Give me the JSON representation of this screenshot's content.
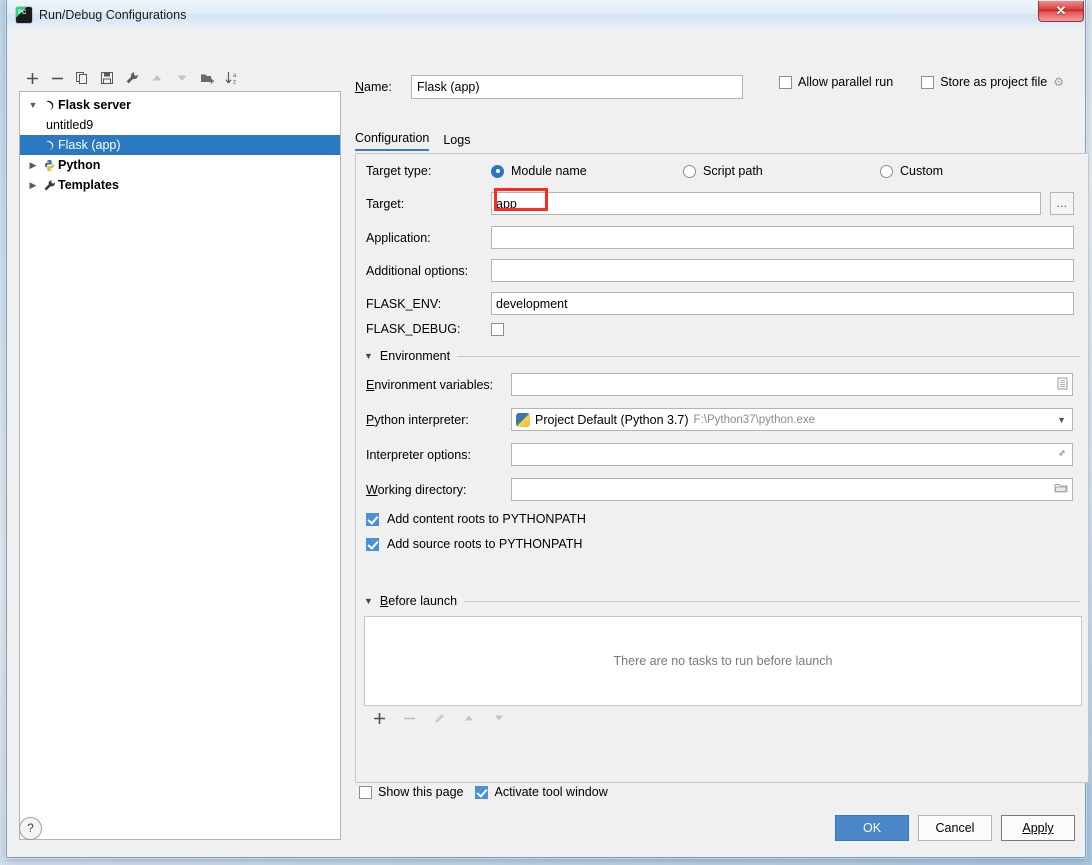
{
  "window": {
    "title": "Run/Debug Configurations",
    "app_icon": "pycharm-icon",
    "close_label": "✕"
  },
  "toolbar": {
    "buttons": [
      {
        "name": "add-configuration-button",
        "icon": "plus-icon",
        "label": "+",
        "disabled": false
      },
      {
        "name": "remove-configuration-button",
        "icon": "minus-icon",
        "label": "−",
        "disabled": false
      },
      {
        "name": "copy-configuration-button",
        "icon": "copy-icon",
        "label": "",
        "disabled": false
      },
      {
        "name": "save-configuration-button",
        "icon": "save-icon",
        "label": "",
        "disabled": false
      },
      {
        "name": "edit-templates-button",
        "icon": "wrench-icon",
        "label": "",
        "disabled": false
      },
      {
        "name": "move-up-button",
        "icon": "arrow-up-icon",
        "label": "▲",
        "disabled": true
      },
      {
        "name": "move-down-button",
        "icon": "arrow-down-icon",
        "label": "▼",
        "disabled": true
      },
      {
        "name": "new-folder-button",
        "icon": "folder-add-icon",
        "label": "",
        "disabled": false
      },
      {
        "name": "sort-configurations-button",
        "icon": "sort-az-icon",
        "label": "",
        "disabled": false
      }
    ]
  },
  "tree": {
    "nodes": [
      {
        "label": "Flask server",
        "indent": 0,
        "twisty": "expanded",
        "icon": "flask-icon",
        "bold": true,
        "selected": false
      },
      {
        "label": "untitled9",
        "indent": 2,
        "twisty": "none",
        "icon": "none",
        "bold": false,
        "selected": false
      },
      {
        "label": "Flask (app)",
        "indent": 1,
        "twisty": "none",
        "icon": "flask-icon",
        "bold": false,
        "selected": true
      },
      {
        "label": "Python",
        "indent": 0,
        "twisty": "collapsed",
        "icon": "python-icon",
        "bold": true,
        "selected": false
      },
      {
        "label": "Templates",
        "indent": 0,
        "twisty": "collapsed",
        "icon": "wrench-icon",
        "bold": true,
        "selected": false
      }
    ]
  },
  "header": {
    "name_label": "Name:",
    "name_value": "Flask (app)",
    "allow_parallel_run_label": "Allow parallel run",
    "allow_parallel_run_checked": false,
    "store_as_project_file_label": "Store as project file",
    "store_as_project_file_checked": false,
    "gear_icon": "gear-icon"
  },
  "tabs": [
    {
      "label": "Configuration",
      "active": true
    },
    {
      "label": "Logs",
      "active": false
    }
  ],
  "form": {
    "target_type_label": "Target type:",
    "target_type_options": [
      {
        "label": "Module name",
        "selected": true
      },
      {
        "label": "Script path",
        "selected": false
      },
      {
        "label": "Custom",
        "selected": false
      }
    ],
    "target_label": "Target:",
    "target_value": "app",
    "target_browse_label": "...",
    "application_label": "Application:",
    "application_value": "",
    "additional_options_label": "Additional options:",
    "additional_options_value": "",
    "flask_env_label": "FLASK_ENV:",
    "flask_env_value": "development",
    "flask_debug_label": "FLASK_DEBUG:",
    "flask_debug_checked": false,
    "environment_section_label": "Environment",
    "environment_variables_label": "Environment variables:",
    "environment_variables_value": "",
    "environment_variables_icon": "list-editor-icon",
    "python_interpreter_label": "Python interpreter:",
    "python_interpreter_value": "Project Default (Python 3.7)",
    "python_interpreter_path": "F:\\Python37\\python.exe",
    "python_interpreter_icon": "python-icon",
    "interpreter_options_label": "Interpreter options:",
    "interpreter_options_value": "",
    "interpreter_options_icon": "expand-icon",
    "working_directory_label": "Working directory:",
    "working_directory_value": "",
    "working_directory_icon": "folder-icon",
    "add_content_roots_label": "Add content roots to PYTHONPATH",
    "add_content_roots_checked": true,
    "add_source_roots_label": "Add source roots to PYTHONPATH",
    "add_source_roots_checked": true
  },
  "before_launch": {
    "section_label": "Before launch",
    "empty_text": "There are no tasks to run before launch",
    "buttons": [
      {
        "name": "add-task-button",
        "icon": "plus-icon",
        "label": "+",
        "disabled": false
      },
      {
        "name": "remove-task-button",
        "icon": "minus-icon",
        "label": "−",
        "disabled": true
      },
      {
        "name": "edit-task-button",
        "icon": "pencil-icon",
        "label": "",
        "disabled": true
      },
      {
        "name": "move-task-up-button",
        "icon": "arrow-up-icon",
        "label": "▲",
        "disabled": true
      },
      {
        "name": "move-task-down-button",
        "icon": "arrow-down-icon",
        "label": "▼",
        "disabled": true
      }
    ]
  },
  "bottom": {
    "show_this_page_label": "Show this page",
    "show_this_page_checked": false,
    "activate_tool_window_label": "Activate tool window",
    "activate_tool_window_checked": true
  },
  "footer": {
    "help_label": "?",
    "ok_label": "OK",
    "cancel_label": "Cancel",
    "apply_label": "Apply"
  },
  "colors": {
    "accent_blue": "#4a86c8",
    "selection_blue": "#2b79c2",
    "highlight_red": "#fd2a1d",
    "tab_underline": "#3a7bc4"
  }
}
